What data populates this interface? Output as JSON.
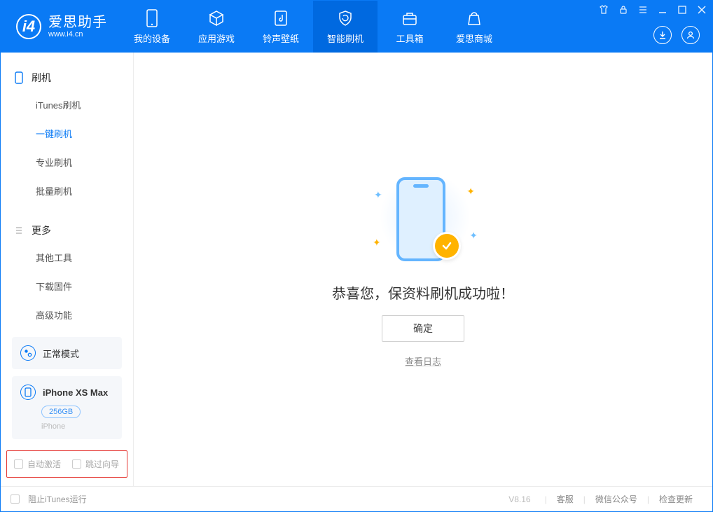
{
  "header": {
    "app_title": "爱思助手",
    "app_url": "www.i4.cn",
    "tabs": [
      {
        "label": "我的设备"
      },
      {
        "label": "应用游戏"
      },
      {
        "label": "铃声壁纸"
      },
      {
        "label": "智能刷机"
      },
      {
        "label": "工具箱"
      },
      {
        "label": "爱思商城"
      }
    ]
  },
  "sidebar": {
    "group1": {
      "title": "刷机",
      "items": [
        {
          "label": "iTunes刷机"
        },
        {
          "label": "一键刷机"
        },
        {
          "label": "专业刷机"
        },
        {
          "label": "批量刷机"
        }
      ]
    },
    "group2": {
      "title": "更多",
      "items": [
        {
          "label": "其他工具"
        },
        {
          "label": "下载固件"
        },
        {
          "label": "高级功能"
        }
      ]
    },
    "mode_label": "正常模式",
    "device": {
      "name": "iPhone XS Max",
      "capacity": "256GB",
      "type": "iPhone"
    },
    "opt_auto_activate": "自动激活",
    "opt_skip_guide": "跳过向导"
  },
  "content": {
    "success_text": "恭喜您，保资料刷机成功啦！",
    "confirm_label": "确定",
    "view_log": "查看日志"
  },
  "footer": {
    "block_itunes": "阻止iTunes运行",
    "version": "V8.16",
    "links": [
      {
        "label": "客服"
      },
      {
        "label": "微信公众号"
      },
      {
        "label": "检查更新"
      }
    ]
  }
}
